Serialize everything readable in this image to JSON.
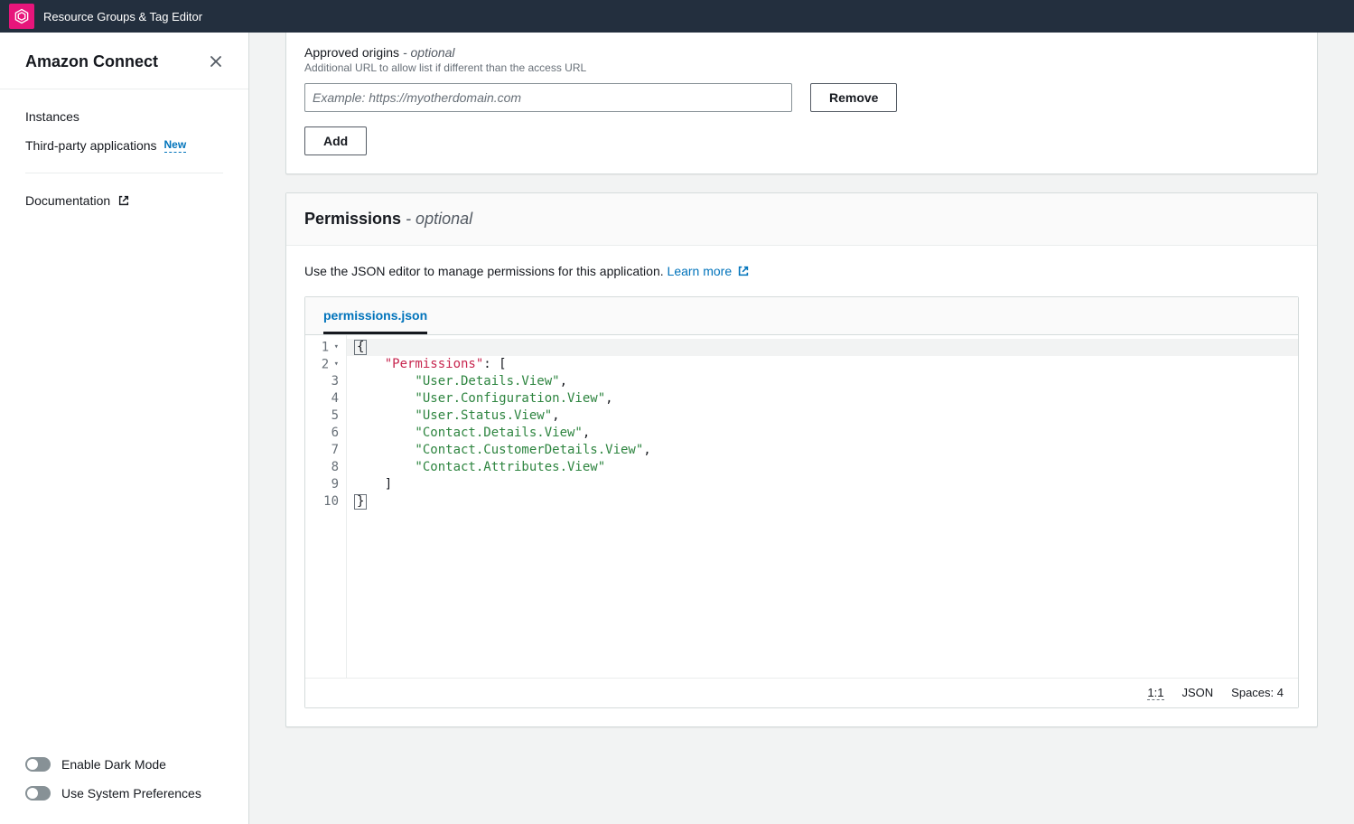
{
  "topbar": {
    "title": "Resource Groups & Tag Editor"
  },
  "sidebar": {
    "title": "Amazon Connect",
    "nav": {
      "instances": "Instances",
      "third_party": "Third-party applications",
      "new_badge": "New"
    },
    "documentation": "Documentation",
    "dark_mode": "Enable Dark Mode",
    "system_prefs": "Use System Preferences"
  },
  "origins": {
    "label": "Approved origins",
    "optional": "- optional",
    "description": "Additional URL to allow list if different than the access URL",
    "placeholder": "Example: https://myotherdomain.com",
    "remove": "Remove",
    "add": "Add"
  },
  "permissions": {
    "title": "Permissions",
    "optional": " - optional",
    "description": "Use the JSON editor to manage permissions for this application. ",
    "learn_more": "Learn more",
    "tab": "permissions.json",
    "code_key": "\"Permissions\"",
    "code_lines": {
      "l1": "{",
      "l2a": "    ",
      "l2b": ": [",
      "l3": "        \"User.Details.View\"",
      "l4": "        \"User.Configuration.View\"",
      "l5": "        \"User.Status.View\"",
      "l6": "        \"Contact.Details.View\"",
      "l7": "        \"Contact.CustomerDetails.View\"",
      "l8": "        \"Contact.Attributes.View\"",
      "l9": "    ]",
      "l10": "}"
    },
    "status": {
      "pos": "1:1",
      "lang": "JSON",
      "spaces": "Spaces: 4"
    }
  }
}
